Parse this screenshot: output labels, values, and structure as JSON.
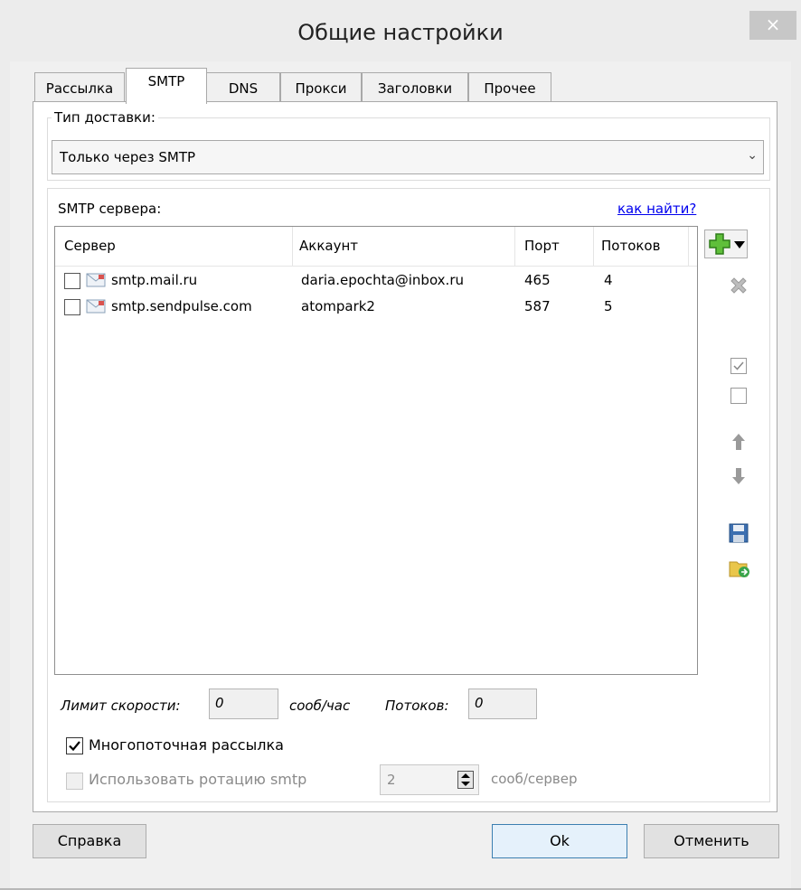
{
  "window": {
    "title": "Общие настройки",
    "close_glyph": "×"
  },
  "tabs": [
    {
      "label": "Рассылка",
      "active": false
    },
    {
      "label": "SMTP",
      "active": true
    },
    {
      "label": "DNS",
      "active": false
    },
    {
      "label": "Прокси",
      "active": false
    },
    {
      "label": "Заголовки",
      "active": false
    },
    {
      "label": "Прочее",
      "active": false
    }
  ],
  "delivery": {
    "label": "Тип доставки:",
    "selected": "Только через SMTP"
  },
  "smtp": {
    "label": "SMTP сервера:",
    "help_link": "как найти?",
    "columns": [
      "Сервер",
      "Аккаунт",
      "Порт",
      "Потоков"
    ],
    "rows": [
      {
        "checked": false,
        "server": "smtp.mail.ru",
        "account": "daria.epochta@inbox.ru",
        "port": "465",
        "threads": "4"
      },
      {
        "checked": false,
        "server": "smtp.sendpulse.com",
        "account": "atompark2",
        "port": "587",
        "threads": "5"
      }
    ],
    "side_icons": [
      "add-icon",
      "dropdown-arrow-icon",
      "delete-icon",
      "check-all-icon",
      "uncheck-all-icon",
      "move-up-icon",
      "move-down-icon",
      "save-icon",
      "load-icon"
    ]
  },
  "limits": {
    "speed_label": "Лимит скорости:",
    "speed_value": "0",
    "speed_unit": "сооб/час",
    "threads_label": "Потоков:",
    "threads_value": "0"
  },
  "options": {
    "multithread_label": "Многопоточная рассылка",
    "multithread_checked": true,
    "rotation_label": "Использовать ротацию smtp",
    "rotation_checked": false,
    "rotation_value": "2",
    "rotation_unit": "сооб/сервер"
  },
  "buttons": {
    "help": "Справка",
    "ok": "Ok",
    "cancel": "Отменить"
  }
}
